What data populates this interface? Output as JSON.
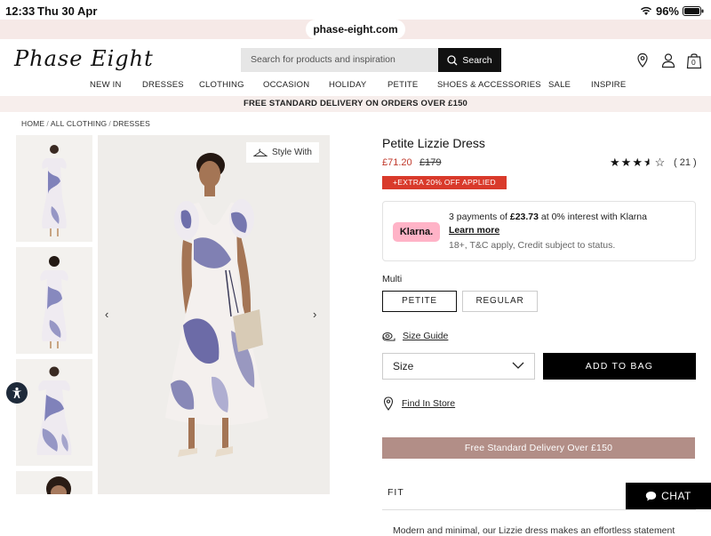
{
  "status_bar": {
    "time": "12:33",
    "date": "Thu 30 Apr",
    "battery": "96%"
  },
  "browser": {
    "url": "phase-eight.com"
  },
  "header": {
    "logo": "Phase Eight",
    "search_placeholder": "Search for products and inspiration",
    "search_button": "Search",
    "bag_count": "0"
  },
  "nav": [
    "NEW IN",
    "DRESSES",
    "CLOTHING",
    "OCCASION",
    "HOLIDAY",
    "PETITE",
    "SHOES & ACCESSORIES",
    "SALE",
    "INSPIRE"
  ],
  "delivery_banner": "FREE STANDARD DELIVERY ON ORDERS OVER £150",
  "breadcrumb": [
    "HOME",
    "ALL CLOTHING",
    "DRESSES"
  ],
  "gallery": {
    "style_with": "Style With"
  },
  "product": {
    "title": "Petite Lizzie Dress",
    "price": "£71.20",
    "was_price": "£179",
    "rating": 3.5,
    "review_count": "( 21 )",
    "promo": "+EXTRA 20% OFF APPLIED"
  },
  "klarna": {
    "badge": "Klarna.",
    "line1_prefix": "3 payments of ",
    "line1_amount": "£23.73",
    "line1_suffix": " at 0% interest with Klarna",
    "learn_more": "Learn more",
    "line3": "18+, T&C apply, Credit subject to status."
  },
  "options": {
    "colour": "Multi",
    "fits": [
      "PETITE",
      "REGULAR"
    ],
    "selected_fit": "PETITE",
    "size_guide": "Size Guide",
    "size_select": "Size",
    "add_to_bag": "ADD TO BAG",
    "find_in_store": "Find In Store"
  },
  "free_delivery_bar": "Free Standard Delivery Over £150",
  "fit_section": "FIT",
  "description": "Modern and minimal, our Lizzie dress makes an effortless statement",
  "chat": "CHAT",
  "colors": {
    "price_red": "#c0392b",
    "promo_red": "#d93a2b",
    "klarna_pink": "#ffb3c7",
    "delivery_bar": "#b28e87"
  }
}
